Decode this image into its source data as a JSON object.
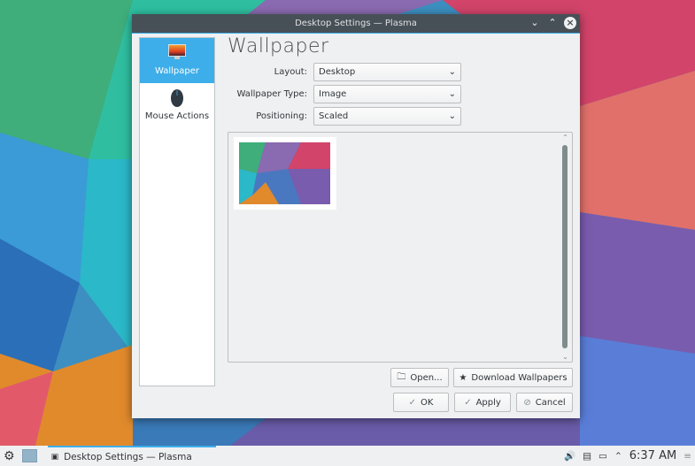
{
  "window": {
    "title": "Desktop Settings — Plasma",
    "buttons": [
      "minimize",
      "maximize",
      "close"
    ]
  },
  "sidebar": {
    "items": [
      {
        "label": "Wallpaper",
        "icon": "monitor-icon",
        "active": true
      },
      {
        "label": "Mouse Actions",
        "icon": "mouse-icon",
        "active": false
      }
    ]
  },
  "main": {
    "title": "Wallpaper",
    "layout": {
      "label": "Layout:",
      "value": "Desktop"
    },
    "wallpaper_type": {
      "label": "Wallpaper Type:",
      "value": "Image"
    },
    "positioning": {
      "label": "Positioning:",
      "value": "Scaled"
    },
    "open_label": "Open...",
    "download_label": "Download Wallpapers",
    "ok_label": "OK",
    "apply_label": "Apply",
    "cancel_label": "Cancel"
  },
  "taskbar": {
    "task": "Desktop Settings — Plasma",
    "clock": "6:37 AM",
    "accent": "#3daee9"
  }
}
